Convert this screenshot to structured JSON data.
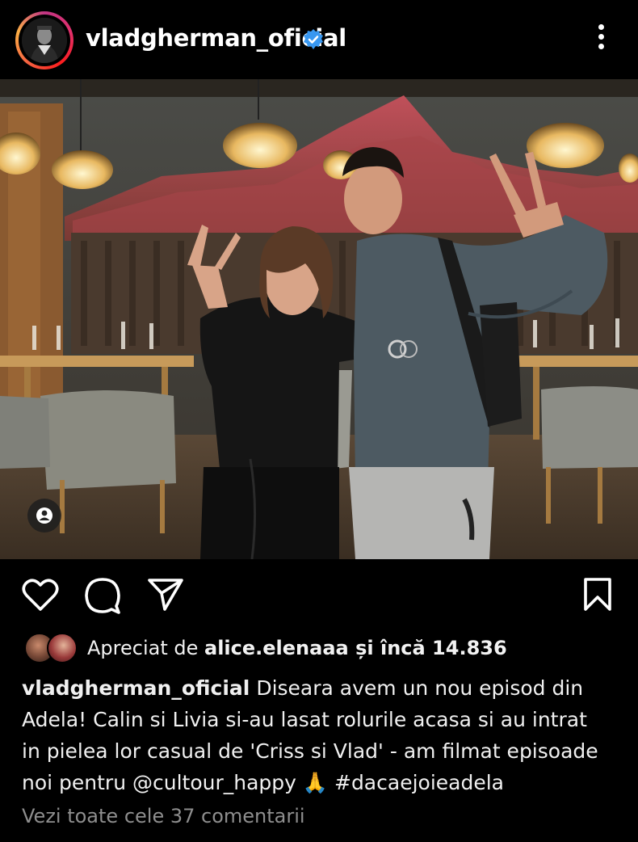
{
  "header": {
    "username": "vladgherman_oficial",
    "verified": true,
    "avatar_icon": "profile-photo",
    "more_icon": "more-vertical-icon"
  },
  "post": {
    "image_description_icon": "photo",
    "tag_icon": "user-tag-icon"
  },
  "actions": {
    "like_icon": "heart-icon",
    "comment_icon": "comment-icon",
    "share_icon": "send-icon",
    "save_icon": "bookmark-icon"
  },
  "likes": {
    "prefix": "Apreciat de ",
    "user": "alice.elenaaa",
    "middle": " și ",
    "count": "încă 14.836"
  },
  "caption": {
    "user": "vladgherman_oficial",
    "line1": " Diseara avem un nou episod din",
    "line2": "Adela! Calin si Livia si-au lasat rolurile acasa si au intrat",
    "line3": "in pielea lor casual de 'Criss si Vlad' - am filmat episoade",
    "line4_a": "noi pentru @cultour_happy ",
    "line4_emoji": "🙏",
    "line4_b": " #dacaejoieadela"
  },
  "comments": {
    "link": "Vezi toate cele 37 comentarii"
  },
  "colors": {
    "background": "#000000",
    "verified": "#3897f0",
    "muted": "#8e8e8e"
  }
}
